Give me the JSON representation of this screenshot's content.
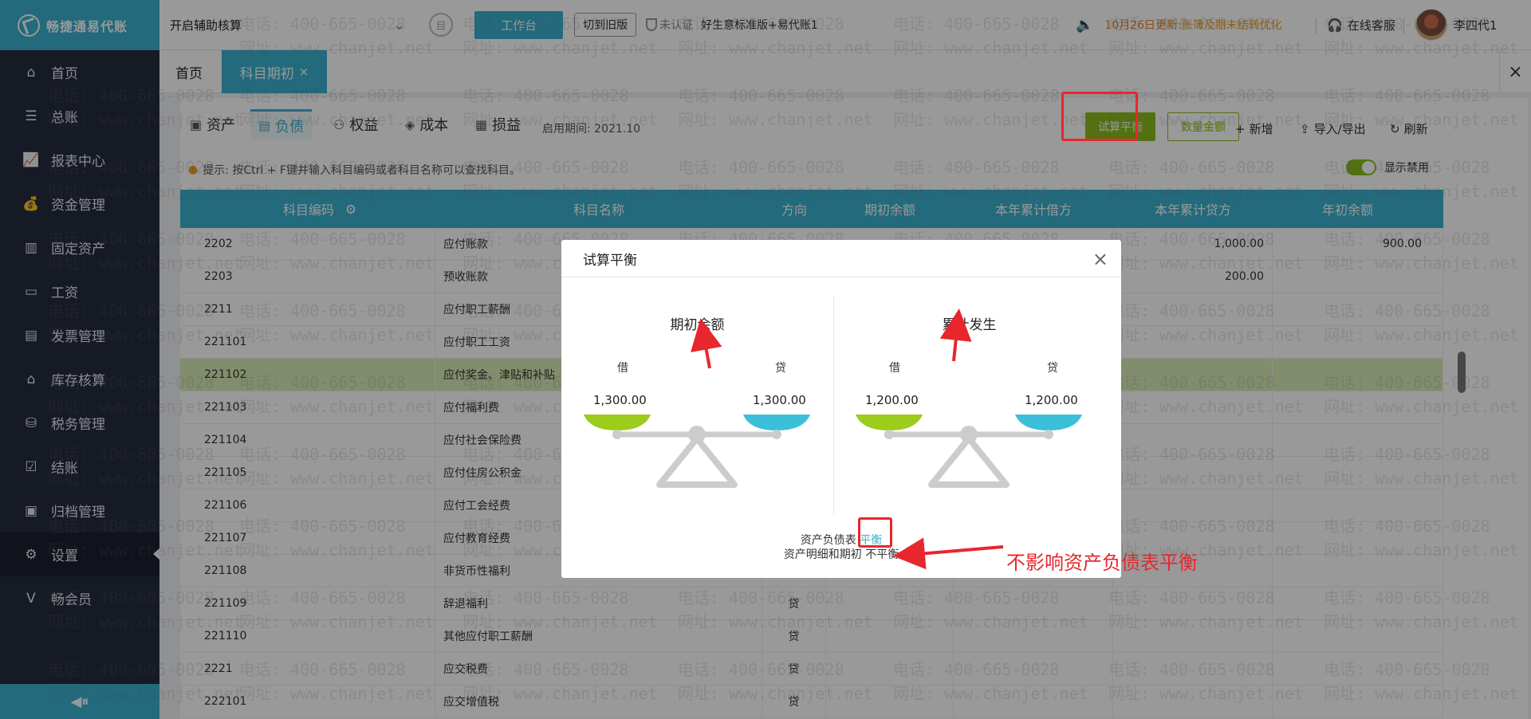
{
  "sidebar": {
    "logo": "畅捷通易代账",
    "items": [
      {
        "label": "首页",
        "icon": "home-icon"
      },
      {
        "label": "总账",
        "icon": "ledger-icon"
      },
      {
        "label": "报表中心",
        "icon": "chart-icon"
      },
      {
        "label": "资金管理",
        "icon": "money-bag-icon"
      },
      {
        "label": "固定资产",
        "icon": "building-icon"
      },
      {
        "label": "工资",
        "icon": "wallet-icon"
      },
      {
        "label": "发票管理",
        "icon": "invoice-icon"
      },
      {
        "label": "库存核算",
        "icon": "warehouse-icon"
      },
      {
        "label": "税务管理",
        "icon": "tax-icon"
      },
      {
        "label": "结账",
        "icon": "checkout-icon"
      },
      {
        "label": "归档管理",
        "icon": "archive-icon"
      },
      {
        "label": "设置",
        "icon": "gear-icon"
      },
      {
        "label": "畅会员",
        "icon": "vip-icon"
      }
    ],
    "active_index": 11
  },
  "topbar": {
    "helper": "开启辅助核算",
    "workbench": "工作台",
    "old_version": "切到旧版",
    "uncertified": "未认证",
    "account_set": "好生意标准版+易代账1",
    "notice_date": "10月26日更新:",
    "notice_text": "账簿及期末结转优化",
    "service": "在线客服",
    "user": "李四代1"
  },
  "tabs": {
    "home": "首页",
    "active": "科目期初"
  },
  "toolbar": {
    "categories": [
      {
        "label": "资产",
        "icon": "asset-icon"
      },
      {
        "label": "负债",
        "icon": "liability-icon"
      },
      {
        "label": "权益",
        "icon": "equity-icon"
      },
      {
        "label": "成本",
        "icon": "cost-icon"
      },
      {
        "label": "损益",
        "icon": "profit-loss-icon"
      }
    ],
    "start_period": "启用期间:  2021.10",
    "trial_balance": "试算平衡",
    "quantity_amount": "数量金额",
    "add": "新增",
    "import_export": "导入/导出",
    "refresh": "刷新",
    "hint": "提示: 按Ctrl + F键并输入科目编码或者科目名称可以查找科目。",
    "show_disabled": "显示禁用"
  },
  "table": {
    "headers": [
      "科目编码",
      "科目名称",
      "方向",
      "期初余额",
      "本年累计借方",
      "本年累计贷方",
      "年初余额"
    ],
    "rows": [
      {
        "code": "2202",
        "name": "应付账款",
        "dir": "",
        "begin": "",
        "debit": "",
        "credit": "1,000.00",
        "year_begin": "900.00"
      },
      {
        "code": "2203",
        "name": "预收账款",
        "dir": "",
        "begin": "",
        "debit": "",
        "credit": "200.00",
        "year_begin": ""
      },
      {
        "code": "2211",
        "name": "应付职工薪酬",
        "dir": "",
        "begin": "",
        "debit": "",
        "credit": "",
        "year_begin": ""
      },
      {
        "code": "221101",
        "name": "应付职工工资",
        "dir": "",
        "begin": "",
        "debit": "",
        "credit": "",
        "year_begin": ""
      },
      {
        "code": "221102",
        "name": "应付奖金、津贴和补贴",
        "dir": "",
        "begin": "",
        "debit": "",
        "credit": "",
        "year_begin": ""
      },
      {
        "code": "221103",
        "name": "应付福利费",
        "dir": "",
        "begin": "",
        "debit": "",
        "credit": "",
        "year_begin": ""
      },
      {
        "code": "221104",
        "name": "应付社会保险费",
        "dir": "",
        "begin": "",
        "debit": "",
        "credit": "",
        "year_begin": ""
      },
      {
        "code": "221105",
        "name": "应付住房公积金",
        "dir": "",
        "begin": "",
        "debit": "",
        "credit": "",
        "year_begin": ""
      },
      {
        "code": "221106",
        "name": "应付工会经费",
        "dir": "",
        "begin": "",
        "debit": "",
        "credit": "",
        "year_begin": ""
      },
      {
        "code": "221107",
        "name": "应付教育经费",
        "dir": "",
        "begin": "",
        "debit": "",
        "credit": "",
        "year_begin": ""
      },
      {
        "code": "221108",
        "name": "非货币性福利",
        "dir": "",
        "begin": "",
        "debit": "",
        "credit": "",
        "year_begin": ""
      },
      {
        "code": "221109",
        "name": "辞退福利",
        "dir": "贷",
        "begin": "",
        "debit": "",
        "credit": "",
        "year_begin": ""
      },
      {
        "code": "221110",
        "name": "其他应付职工薪酬",
        "dir": "贷",
        "begin": "",
        "debit": "",
        "credit": "",
        "year_begin": ""
      },
      {
        "code": "2221",
        "name": "应交税费",
        "dir": "贷",
        "begin": "",
        "debit": "",
        "credit": "",
        "year_begin": ""
      },
      {
        "code": "222101",
        "name": "应交增值税",
        "dir": "贷",
        "begin": "",
        "debit": "",
        "credit": "",
        "year_begin": ""
      }
    ],
    "highlight_index": 4
  },
  "watermark": {
    "phone": "电话: 400-665-0028",
    "site": "网址: www.chanjet.net"
  },
  "dialog": {
    "title": "试算平衡",
    "opening": {
      "title": "期初余额",
      "debit_label": "借",
      "credit_label": "贷",
      "debit": "1,300.00",
      "credit": "1,300.00"
    },
    "accumulated": {
      "title": "累计发生",
      "debit_label": "借",
      "credit_label": "贷",
      "debit": "1,200.00",
      "credit": "1,200.00"
    },
    "status_line1_prefix": "资产负债表",
    "status_line1_value": "平衡",
    "status_line2": "资产明细和期初 不平衡"
  },
  "annotation": "不影响资产负债表平衡",
  "colors": {
    "accent": "#39b1cf",
    "green": "#8cbd1e",
    "annotation": "#e8262d",
    "sidebar": "#252c3c"
  }
}
